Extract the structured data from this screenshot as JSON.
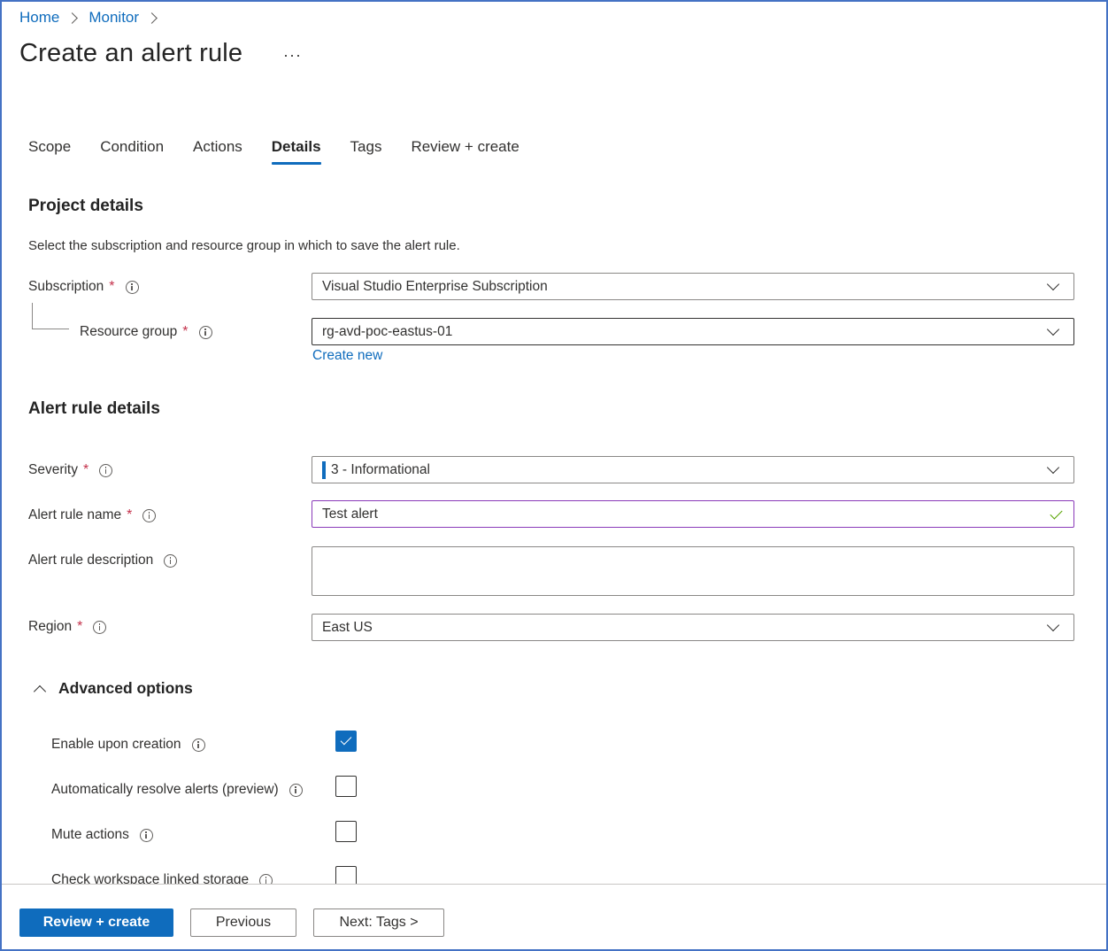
{
  "breadcrumb": {
    "items": [
      "Home",
      "Monitor"
    ]
  },
  "page": {
    "title": "Create an alert rule",
    "more": "···"
  },
  "tabs": [
    "Scope",
    "Condition",
    "Actions",
    "Details",
    "Tags",
    "Review + create"
  ],
  "active_tab": "Details",
  "project_details": {
    "title": "Project details",
    "description": "Select the subscription and resource group in which to save the alert rule.",
    "subscription_label": "Subscription",
    "subscription_value": "Visual Studio Enterprise Subscription",
    "resource_group_label": "Resource group",
    "resource_group_value": "rg-avd-poc-eastus-01",
    "create_new": "Create new"
  },
  "alert_rule_details": {
    "title": "Alert rule details",
    "severity_label": "Severity",
    "severity_value": "3 - Informational",
    "name_label": "Alert rule name",
    "name_value": "Test alert",
    "description_label": "Alert rule description",
    "description_value": "",
    "region_label": "Region",
    "region_value": "East US"
  },
  "advanced": {
    "title": "Advanced options",
    "options": [
      {
        "label": "Enable upon creation",
        "checked": true
      },
      {
        "label": "Automatically resolve alerts (preview)",
        "checked": false
      },
      {
        "label": "Mute actions",
        "checked": false
      },
      {
        "label": "Check workspace linked storage",
        "checked": false
      }
    ]
  },
  "required_mark": "*",
  "footer": {
    "review_create": "Review + create",
    "previous": "Previous",
    "next": "Next: Tags >"
  },
  "colors": {
    "accent": "#0f6cbd",
    "required": "#c4314b",
    "valid": "#57a300",
    "focus_border": "#8a3ab9"
  }
}
